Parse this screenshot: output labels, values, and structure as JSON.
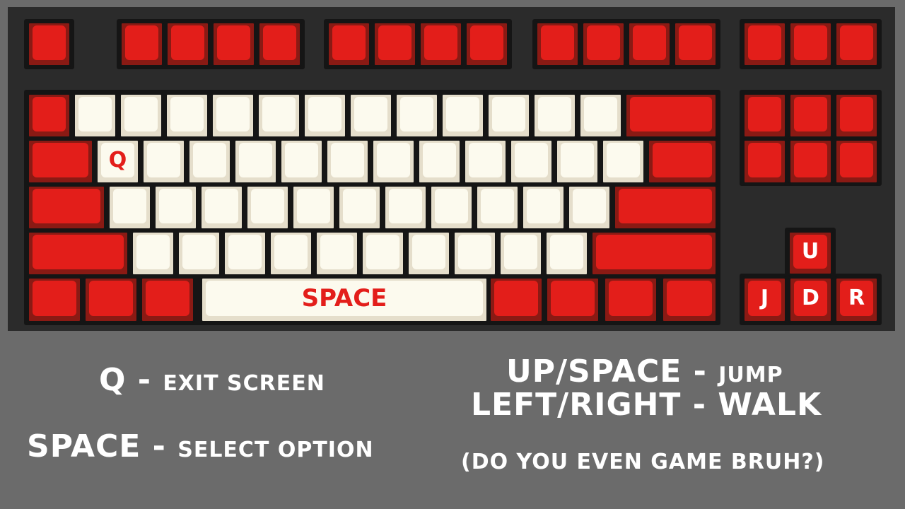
{
  "keyboard": {
    "legends": {
      "q": "Q",
      "space": "SPACE",
      "up": "U",
      "left": "J",
      "down": "D",
      "right": "R"
    }
  },
  "instructions": {
    "q_key": "Q",
    "q_action": "EXIT SCREEN",
    "space_key": "SPACE",
    "space_action": "SELECT OPTION",
    "jump_keys": "UP/SPACE",
    "jump_action": "JUMP",
    "walk_keys": "LEFT/RIGHT",
    "walk_action": "WALK",
    "joke": "(DO YOU EVEN GAME BRUH?)",
    "separator": " - "
  },
  "colors": {
    "key_red": "#e31e1a",
    "key_cream": "#fcfaee",
    "keyboard_bg": "#2b2b2b",
    "page_bg": "#6b6b6b"
  }
}
